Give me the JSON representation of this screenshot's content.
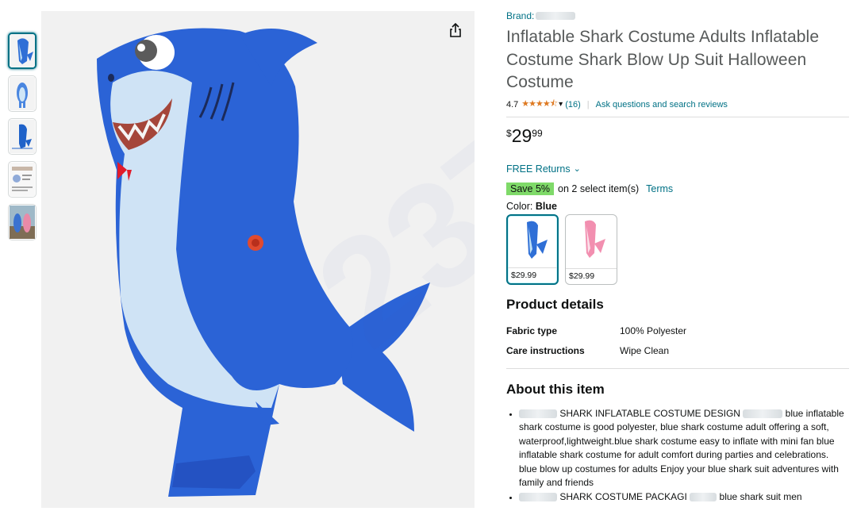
{
  "thumbnails": [
    {
      "name": "thumb-blue-shark-side",
      "selected": true
    },
    {
      "name": "thumb-blue-shark-front",
      "selected": false
    },
    {
      "name": "thumb-blue-shark-pose",
      "selected": false
    },
    {
      "name": "thumb-info-sheet",
      "selected": false
    },
    {
      "name": "thumb-outdoor-photo",
      "selected": false
    }
  ],
  "product": {
    "brand_label": "Brand:",
    "title": "Inflatable Shark Costume Adults Inflatable Costume Shark Blow Up Suit Halloween Costume",
    "rating_value": "4.7",
    "stars": "★★★★⯪",
    "rating_count": "(16)",
    "ask_link": "Ask questions and search reviews",
    "price_symbol": "$",
    "price_whole": "29",
    "price_fraction": "99",
    "free_returns": "FREE Returns",
    "save_badge": "Save 5%",
    "save_text": "on 2 select item(s)",
    "terms": "Terms",
    "color_label": "Color:",
    "color_value": "Blue",
    "swatches": [
      {
        "price": "$29.99",
        "color": "#2f6fd6"
      },
      {
        "price": "$29.99",
        "color": "#f28fb0"
      }
    ]
  },
  "product_details": {
    "heading": "Product details",
    "rows": [
      {
        "key": "Fabric type",
        "value": "100% Polyester"
      },
      {
        "key": "Care instructions",
        "value": "Wipe Clean"
      }
    ]
  },
  "about": {
    "heading": "About this item",
    "bullets": [
      {
        "line1": "SHARK INFLATABLE COSTUME DESIGN",
        "line1_tail": "blue inflatable",
        "rest": "shark costume is good polyester, blue shark costume adult offering a soft, waterproof,lightweight.blue shark costume easy to inflate with mini fan blue inflatable shark costume for adult comfort during parties and celebrations. blue blow up costumes for adults Enjoy your blue shark suit adventures with family and friends"
      },
      {
        "line1": "SHARK COSTUME PACKAGI",
        "line1_tail": "blue shark suit men",
        "rest": ""
      }
    ]
  },
  "colors": {
    "link": "#007185",
    "star": "#de7921",
    "save_badge": "#7fda69",
    "shark_blue": "#2f6fd6"
  }
}
